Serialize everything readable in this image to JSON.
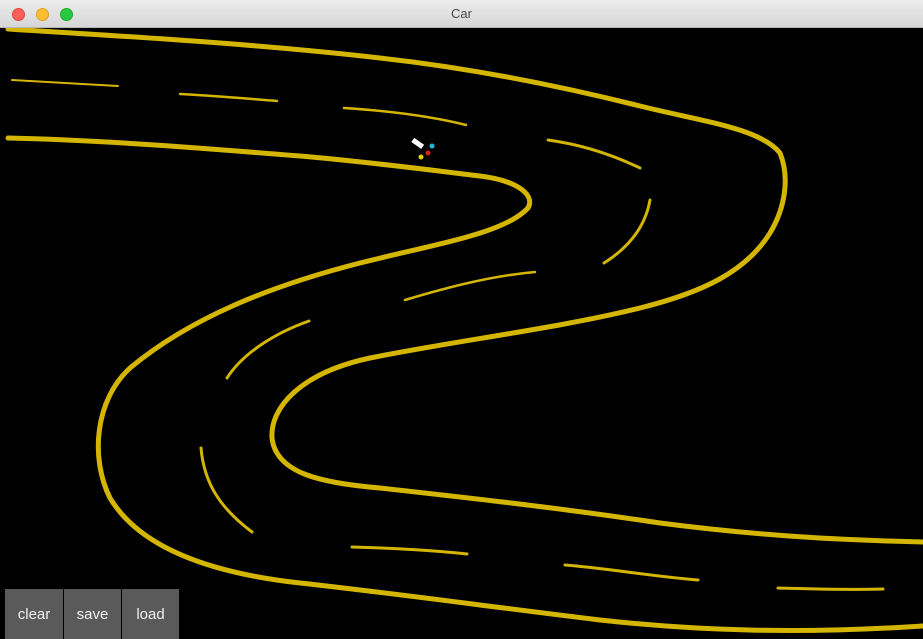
{
  "window": {
    "title": "Car"
  },
  "toolbar": {
    "clear_label": "clear",
    "save_label": "save",
    "load_label": "load"
  },
  "colors": {
    "road": "#d4b600",
    "background": "#000000",
    "car": "#ffffff",
    "sensor_left": "#1cb8e0",
    "sensor_center": "#e02020",
    "sensor_right": "#e8d000"
  }
}
